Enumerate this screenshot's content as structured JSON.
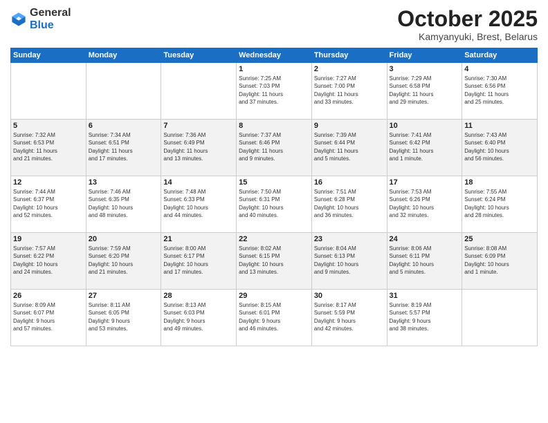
{
  "header": {
    "logo_general": "General",
    "logo_blue": "Blue",
    "month_title": "October 2025",
    "location": "Kamyanyuki, Brest, Belarus"
  },
  "days_of_week": [
    "Sunday",
    "Monday",
    "Tuesday",
    "Wednesday",
    "Thursday",
    "Friday",
    "Saturday"
  ],
  "weeks": [
    [
      {
        "day": "",
        "info": ""
      },
      {
        "day": "",
        "info": ""
      },
      {
        "day": "",
        "info": ""
      },
      {
        "day": "1",
        "info": "Sunrise: 7:25 AM\nSunset: 7:03 PM\nDaylight: 11 hours\nand 37 minutes."
      },
      {
        "day": "2",
        "info": "Sunrise: 7:27 AM\nSunset: 7:00 PM\nDaylight: 11 hours\nand 33 minutes."
      },
      {
        "day": "3",
        "info": "Sunrise: 7:29 AM\nSunset: 6:58 PM\nDaylight: 11 hours\nand 29 minutes."
      },
      {
        "day": "4",
        "info": "Sunrise: 7:30 AM\nSunset: 6:56 PM\nDaylight: 11 hours\nand 25 minutes."
      }
    ],
    [
      {
        "day": "5",
        "info": "Sunrise: 7:32 AM\nSunset: 6:53 PM\nDaylight: 11 hours\nand 21 minutes."
      },
      {
        "day": "6",
        "info": "Sunrise: 7:34 AM\nSunset: 6:51 PM\nDaylight: 11 hours\nand 17 minutes."
      },
      {
        "day": "7",
        "info": "Sunrise: 7:36 AM\nSunset: 6:49 PM\nDaylight: 11 hours\nand 13 minutes."
      },
      {
        "day": "8",
        "info": "Sunrise: 7:37 AM\nSunset: 6:46 PM\nDaylight: 11 hours\nand 9 minutes."
      },
      {
        "day": "9",
        "info": "Sunrise: 7:39 AM\nSunset: 6:44 PM\nDaylight: 11 hours\nand 5 minutes."
      },
      {
        "day": "10",
        "info": "Sunrise: 7:41 AM\nSunset: 6:42 PM\nDaylight: 11 hours\nand 1 minute."
      },
      {
        "day": "11",
        "info": "Sunrise: 7:43 AM\nSunset: 6:40 PM\nDaylight: 10 hours\nand 56 minutes."
      }
    ],
    [
      {
        "day": "12",
        "info": "Sunrise: 7:44 AM\nSunset: 6:37 PM\nDaylight: 10 hours\nand 52 minutes."
      },
      {
        "day": "13",
        "info": "Sunrise: 7:46 AM\nSunset: 6:35 PM\nDaylight: 10 hours\nand 48 minutes."
      },
      {
        "day": "14",
        "info": "Sunrise: 7:48 AM\nSunset: 6:33 PM\nDaylight: 10 hours\nand 44 minutes."
      },
      {
        "day": "15",
        "info": "Sunrise: 7:50 AM\nSunset: 6:31 PM\nDaylight: 10 hours\nand 40 minutes."
      },
      {
        "day": "16",
        "info": "Sunrise: 7:51 AM\nSunset: 6:28 PM\nDaylight: 10 hours\nand 36 minutes."
      },
      {
        "day": "17",
        "info": "Sunrise: 7:53 AM\nSunset: 6:26 PM\nDaylight: 10 hours\nand 32 minutes."
      },
      {
        "day": "18",
        "info": "Sunrise: 7:55 AM\nSunset: 6:24 PM\nDaylight: 10 hours\nand 28 minutes."
      }
    ],
    [
      {
        "day": "19",
        "info": "Sunrise: 7:57 AM\nSunset: 6:22 PM\nDaylight: 10 hours\nand 24 minutes."
      },
      {
        "day": "20",
        "info": "Sunrise: 7:59 AM\nSunset: 6:20 PM\nDaylight: 10 hours\nand 21 minutes."
      },
      {
        "day": "21",
        "info": "Sunrise: 8:00 AM\nSunset: 6:17 PM\nDaylight: 10 hours\nand 17 minutes."
      },
      {
        "day": "22",
        "info": "Sunrise: 8:02 AM\nSunset: 6:15 PM\nDaylight: 10 hours\nand 13 minutes."
      },
      {
        "day": "23",
        "info": "Sunrise: 8:04 AM\nSunset: 6:13 PM\nDaylight: 10 hours\nand 9 minutes."
      },
      {
        "day": "24",
        "info": "Sunrise: 8:06 AM\nSunset: 6:11 PM\nDaylight: 10 hours\nand 5 minutes."
      },
      {
        "day": "25",
        "info": "Sunrise: 8:08 AM\nSunset: 6:09 PM\nDaylight: 10 hours\nand 1 minute."
      }
    ],
    [
      {
        "day": "26",
        "info": "Sunrise: 8:09 AM\nSunset: 6:07 PM\nDaylight: 9 hours\nand 57 minutes."
      },
      {
        "day": "27",
        "info": "Sunrise: 8:11 AM\nSunset: 6:05 PM\nDaylight: 9 hours\nand 53 minutes."
      },
      {
        "day": "28",
        "info": "Sunrise: 8:13 AM\nSunset: 6:03 PM\nDaylight: 9 hours\nand 49 minutes."
      },
      {
        "day": "29",
        "info": "Sunrise: 8:15 AM\nSunset: 6:01 PM\nDaylight: 9 hours\nand 46 minutes."
      },
      {
        "day": "30",
        "info": "Sunrise: 8:17 AM\nSunset: 5:59 PM\nDaylight: 9 hours\nand 42 minutes."
      },
      {
        "day": "31",
        "info": "Sunrise: 8:19 AM\nSunset: 5:57 PM\nDaylight: 9 hours\nand 38 minutes."
      },
      {
        "day": "",
        "info": ""
      }
    ]
  ]
}
